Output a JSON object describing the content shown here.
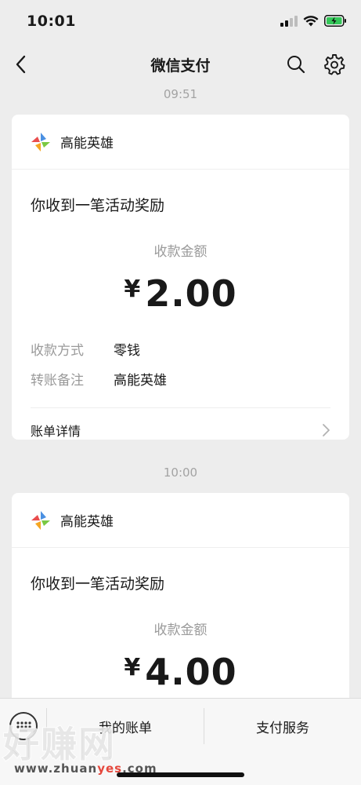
{
  "status_bar": {
    "time": "10:01"
  },
  "nav": {
    "title": "微信支付"
  },
  "messages": [
    {
      "timestamp": "09:51",
      "brand": "高能英雄",
      "headline": "你收到一笔活动奖励",
      "amount_label": "收款金额",
      "currency": "¥",
      "amount": "2.00",
      "details": [
        {
          "key": "收款方式",
          "value": "零钱"
        },
        {
          "key": "转账备注",
          "value": "高能英雄"
        }
      ],
      "bill_link": "账单详情"
    },
    {
      "timestamp": "10:00",
      "brand": "高能英雄",
      "headline": "你收到一笔活动奖励",
      "amount_label": "收款金额",
      "currency": "¥",
      "amount": "4.00"
    }
  ],
  "bottom_bar": {
    "tab_bills": "我的账单",
    "tab_services": "支付服务"
  },
  "watermark": {
    "text": "好赚网",
    "url_prefix": "www.zhuan",
    "url_accent": "yes",
    "url_suffix": ".com"
  },
  "colors": {
    "background": "#ededed",
    "card": "#ffffff",
    "muted_text": "#9a9a9a",
    "battery_green": "#34c759"
  }
}
